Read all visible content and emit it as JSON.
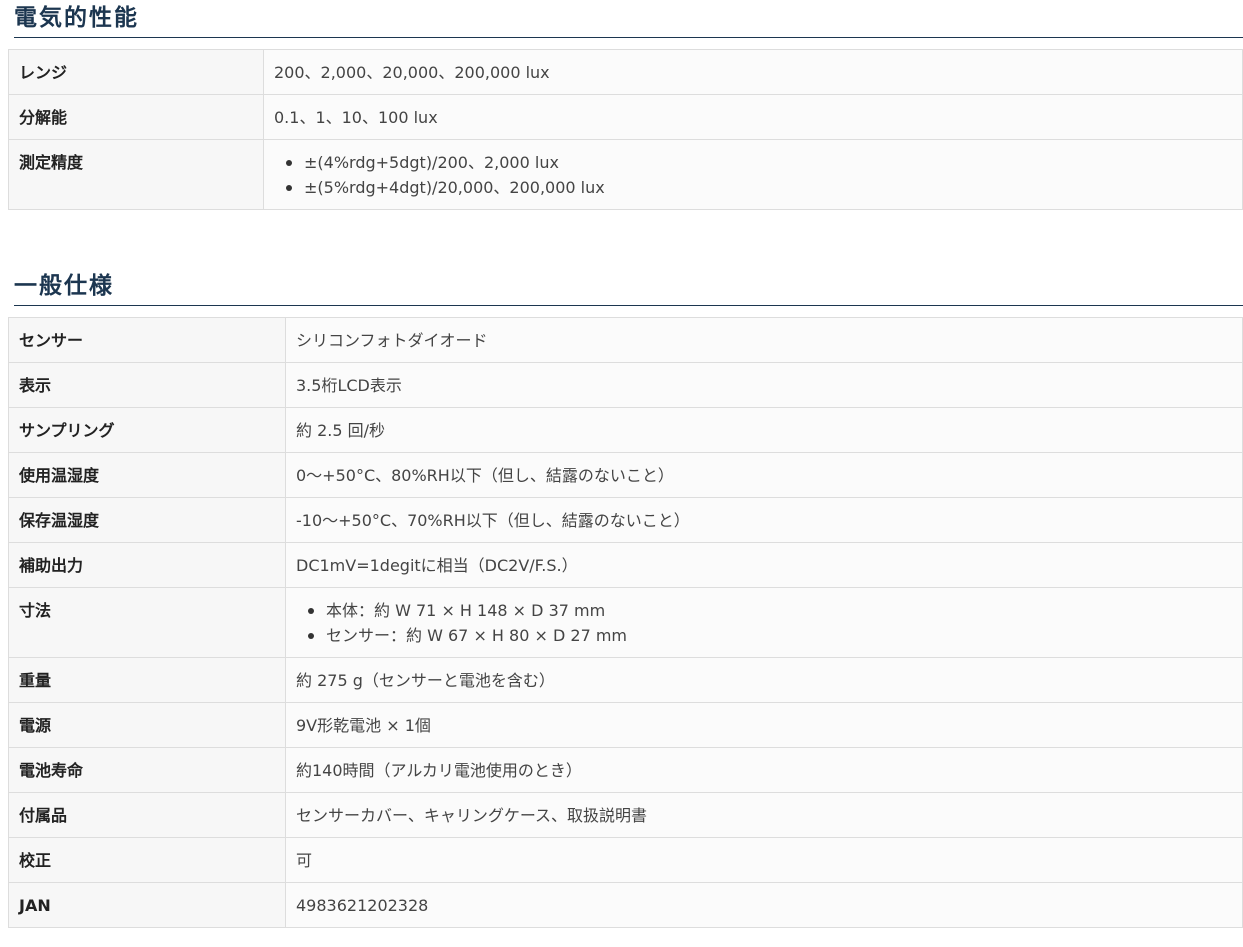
{
  "sections": {
    "electrical": {
      "title": "電気的性能",
      "rows": [
        {
          "label": "レンジ",
          "value": "200、2,000、20,000、200,000 lux"
        },
        {
          "label": "分解能",
          "value": "0.1、1、10、100 lux"
        },
        {
          "label": "測定精度",
          "list": [
            "±(4%rdg+5dgt)/200、2,000 lux",
            "±(5%rdg+4dgt)/20,000、200,000 lux"
          ]
        }
      ]
    },
    "general": {
      "title": "一般仕様",
      "rows": [
        {
          "label": "センサー",
          "value": "シリコンフォトダイオード"
        },
        {
          "label": "表示",
          "value": "3.5桁LCD表示"
        },
        {
          "label": "サンプリング",
          "value": "約 2.5 回/秒"
        },
        {
          "label": "使用温湿度",
          "value": "0〜+50°C、80%RH以下（但し、結露のないこと）"
        },
        {
          "label": "保存温湿度",
          "value": "-10〜+50°C、70%RH以下（但し、結露のないこと）"
        },
        {
          "label": "補助出力",
          "value": "DC1mV=1degitに相当（DC2V/F.S.）"
        },
        {
          "label": "寸法",
          "list": [
            "本体：約 W 71 × H 148 × D 37 mm",
            "センサー：約 W 67 × H 80 × D 27 mm"
          ]
        },
        {
          "label": "重量",
          "value": "約 275 g（センサーと電池を含む）"
        },
        {
          "label": "電源",
          "value": "9V形乾電池 × 1個"
        },
        {
          "label": "電池寿命",
          "value": "約140時間（アルカリ電池使用のとき）"
        },
        {
          "label": "付属品",
          "value": "センサーカバー、キャリングケース、取扱説明書"
        },
        {
          "label": "校正",
          "value": "可"
        },
        {
          "label": "JAN",
          "value": "4983621202328"
        }
      ]
    }
  }
}
